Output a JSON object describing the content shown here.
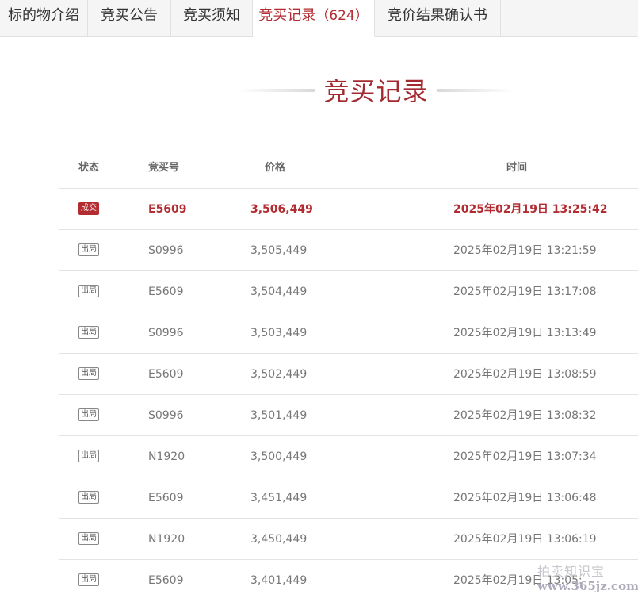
{
  "tabs": [
    {
      "label": "标的物介绍",
      "count": ""
    },
    {
      "label": "竞买公告",
      "count": ""
    },
    {
      "label": "竞买须知",
      "count": ""
    },
    {
      "label": "竞买记录",
      "count": "（624）"
    },
    {
      "label": "竞价结果确认书",
      "count": ""
    }
  ],
  "section_title": "竞买记录",
  "table": {
    "headers": [
      "状态",
      "竞买号",
      "价格",
      "时间"
    ],
    "rows": [
      {
        "status": "成交",
        "bid_no": "E5609",
        "price": "3,506,449",
        "time": "2025年02月19日 13:25:42"
      },
      {
        "status": "出局",
        "bid_no": "S0996",
        "price": "3,505,449",
        "time": "2025年02月19日 13:21:59"
      },
      {
        "status": "出局",
        "bid_no": "E5609",
        "price": "3,504,449",
        "time": "2025年02月19日 13:17:08"
      },
      {
        "status": "出局",
        "bid_no": "S0996",
        "price": "3,503,449",
        "time": "2025年02月19日 13:13:49"
      },
      {
        "status": "出局",
        "bid_no": "E5609",
        "price": "3,502,449",
        "time": "2025年02月19日 13:08:59"
      },
      {
        "status": "出局",
        "bid_no": "S0996",
        "price": "3,501,449",
        "time": "2025年02月19日 13:08:32"
      },
      {
        "status": "出局",
        "bid_no": "N1920",
        "price": "3,500,449",
        "time": "2025年02月19日 13:07:34"
      },
      {
        "status": "出局",
        "bid_no": "E5609",
        "price": "3,451,449",
        "time": "2025年02月19日 13:06:48"
      },
      {
        "status": "出局",
        "bid_no": "N1920",
        "price": "3,450,449",
        "time": "2025年02月19日 13:06:19"
      },
      {
        "status": "出局",
        "bid_no": "E5609",
        "price": "3,401,449",
        "time": "2025年02月19日 13:05:"
      }
    ]
  },
  "watermark": {
    "text": "拍卖知识宝",
    "url": "www.365jz.com"
  },
  "colors": {
    "accent": "#b32c32",
    "tab_bg": "#f5f5f5",
    "border": "#e3e3e3"
  }
}
